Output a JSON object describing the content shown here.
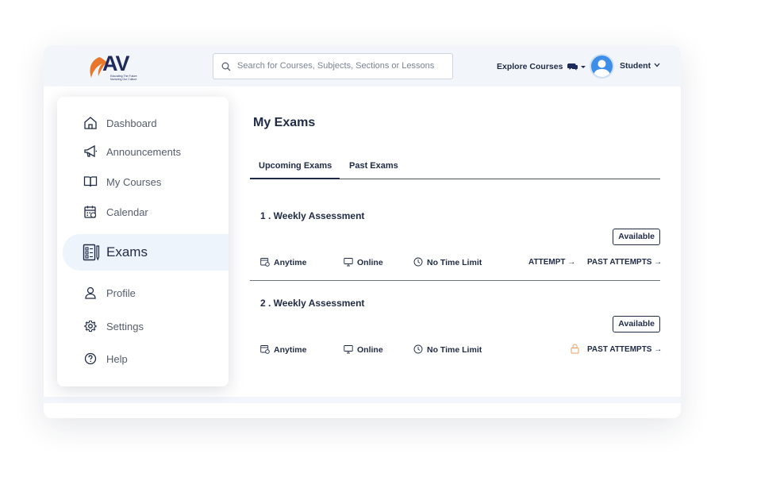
{
  "header": {
    "logo_text": "AV",
    "logo_tagline_1": "Educating The Future",
    "logo_tagline_2": "Nurturing Our Culture",
    "search_placeholder": "Search for Courses, Subjects, Sections or Lessons",
    "explore_label": "Explore Courses",
    "user_label": "Student"
  },
  "sidebar": {
    "items": [
      {
        "label": "Dashboard",
        "icon": "home-icon"
      },
      {
        "label": "Announcements",
        "icon": "megaphone-icon"
      },
      {
        "label": "My Courses",
        "icon": "book-icon"
      },
      {
        "label": "Calendar",
        "icon": "calendar-icon"
      },
      {
        "label": "Exams",
        "icon": "exam-icon",
        "active": true
      },
      {
        "label": "Profile",
        "icon": "user-icon"
      },
      {
        "label": "Settings",
        "icon": "gear-icon"
      },
      {
        "label": "Help",
        "icon": "help-icon"
      }
    ]
  },
  "main": {
    "title": "My Exams",
    "tabs": [
      {
        "label": "Upcoming Exams",
        "active": true
      },
      {
        "label": "Past Exams",
        "active": false
      }
    ],
    "exams": [
      {
        "title": "1 . Weekly Assessment",
        "status": "Available",
        "availability": "Anytime",
        "mode": "Online",
        "time_limit": "No Time Limit",
        "attempt_label": "ATTEMPT →",
        "past_attempts_label": "PAST ATTEMPTS →",
        "locked": false
      },
      {
        "title": "2 . Weekly Assessment",
        "status": "Available",
        "availability": "Anytime",
        "mode": "Online",
        "time_limit": "No Time Limit",
        "past_attempts_label": "PAST ATTEMPTS →",
        "locked": true
      }
    ]
  },
  "colors": {
    "primary_text": "#1f2a44",
    "accent_blue": "#3d8ee8",
    "logo_orange": "#e8762b",
    "active_bg": "#eef4fc",
    "lock_orange": "#e8a060"
  }
}
